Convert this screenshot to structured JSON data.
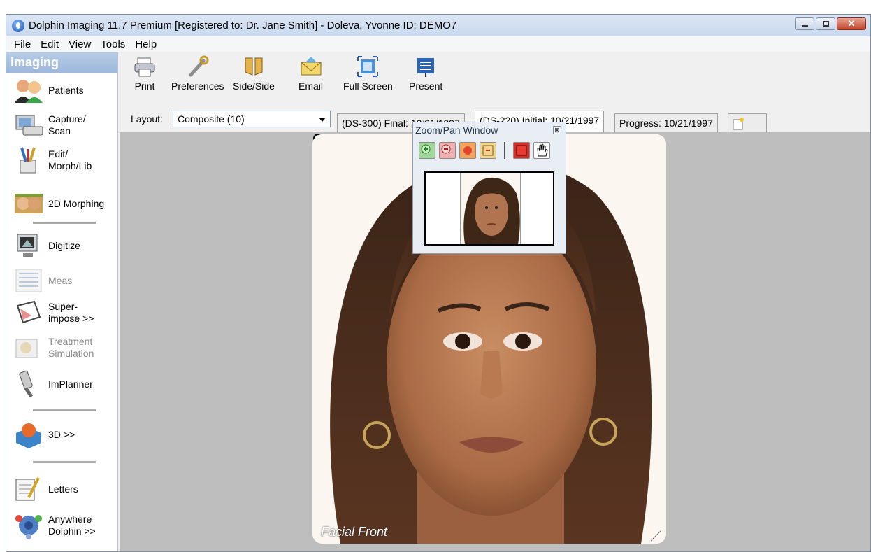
{
  "window": {
    "title": "Dolphin Imaging 11.7 Premium [Registered to: Dr. Jane Smith] - Doleva, Yvonne  ID: DEMO7"
  },
  "menu": [
    "File",
    "Edit",
    "View",
    "Tools",
    "Help"
  ],
  "sidebar": {
    "header": "Imaging",
    "items": [
      {
        "label": "Patients",
        "icon": "patients-icon"
      },
      {
        "label": "Capture/\nScan",
        "icon": "capture-scan-icon"
      },
      {
        "label": "Edit/\nMorph/Lib",
        "icon": "edit-morph-icon"
      },
      {
        "label": "2D Morphing",
        "icon": "2d-morphing-icon"
      },
      {
        "label": "Digitize",
        "icon": "digitize-icon"
      },
      {
        "label": "Meas",
        "icon": "meas-icon"
      },
      {
        "label": "Super-\nimpose >>",
        "icon": "superimpose-icon"
      },
      {
        "label": "Treatment\nSimulation",
        "icon": "treatment-simulation-icon"
      },
      {
        "label": "ImPlanner",
        "icon": "implanner-icon"
      },
      {
        "label": "3D >>",
        "icon": "3d-icon"
      },
      {
        "label": "Letters",
        "icon": "letters-icon"
      },
      {
        "label": "Anywhere\nDolphin >>",
        "icon": "anywhere-dolphin-icon"
      }
    ]
  },
  "toolbar": {
    "buttons": [
      {
        "label": "Print",
        "icon": "printer-icon"
      },
      {
        "label": "Preferences",
        "icon": "wrench-icon"
      },
      {
        "label": "Side/Side",
        "icon": "side-by-side-icon"
      },
      {
        "label": "Email",
        "icon": "email-icon"
      },
      {
        "label": "Full Screen",
        "icon": "full-screen-icon"
      },
      {
        "label": "Present",
        "icon": "present-icon"
      }
    ]
  },
  "layout": {
    "label": "Layout:",
    "selected": "Composite (10)"
  },
  "tabs": [
    {
      "label": "(DS-300) Final: 10/21/1997",
      "active": false
    },
    {
      "label": "(DS-220) Initial: 10/21/1997",
      "active": true
    },
    {
      "label": "Progress: 10/21/1997",
      "active": false
    }
  ],
  "photo": {
    "caption": "Facial Front"
  },
  "zoom_pan": {
    "title": "Zoom/Pan Window",
    "close": "⊠"
  },
  "colors": {
    "canvas_bg": "#bebebe",
    "sidebar_header": "#9db8dc",
    "title_bar": "#c9d9ee"
  }
}
